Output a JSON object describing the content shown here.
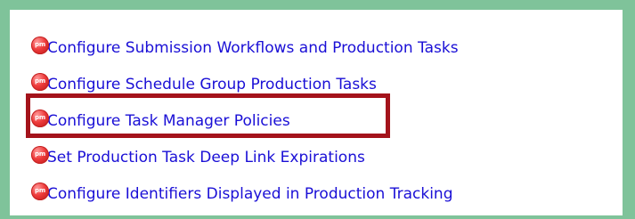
{
  "links": [
    {
      "label": "Configure Submission Workflows and Production Tasks",
      "icon": "pm-icon",
      "icon_text": "pm"
    },
    {
      "label": "Configure Schedule Group Production Tasks",
      "icon": "pm-icon",
      "icon_text": "pm"
    },
    {
      "label": "Configure Task Manager Policies",
      "icon": "pm-icon",
      "icon_text": "pm",
      "highlighted": true
    },
    {
      "label": "Set Production Task Deep Link Expirations",
      "icon": "pm-icon",
      "icon_text": "pm"
    },
    {
      "label": "Configure Identifiers Displayed in Production Tracking",
      "icon": "pm-icon",
      "icon_text": "pm"
    }
  ],
  "colors": {
    "link": "#1a0fd6",
    "icon": "#ee3b3b",
    "frame": "#7fc39a",
    "highlight": "#a4131b"
  }
}
